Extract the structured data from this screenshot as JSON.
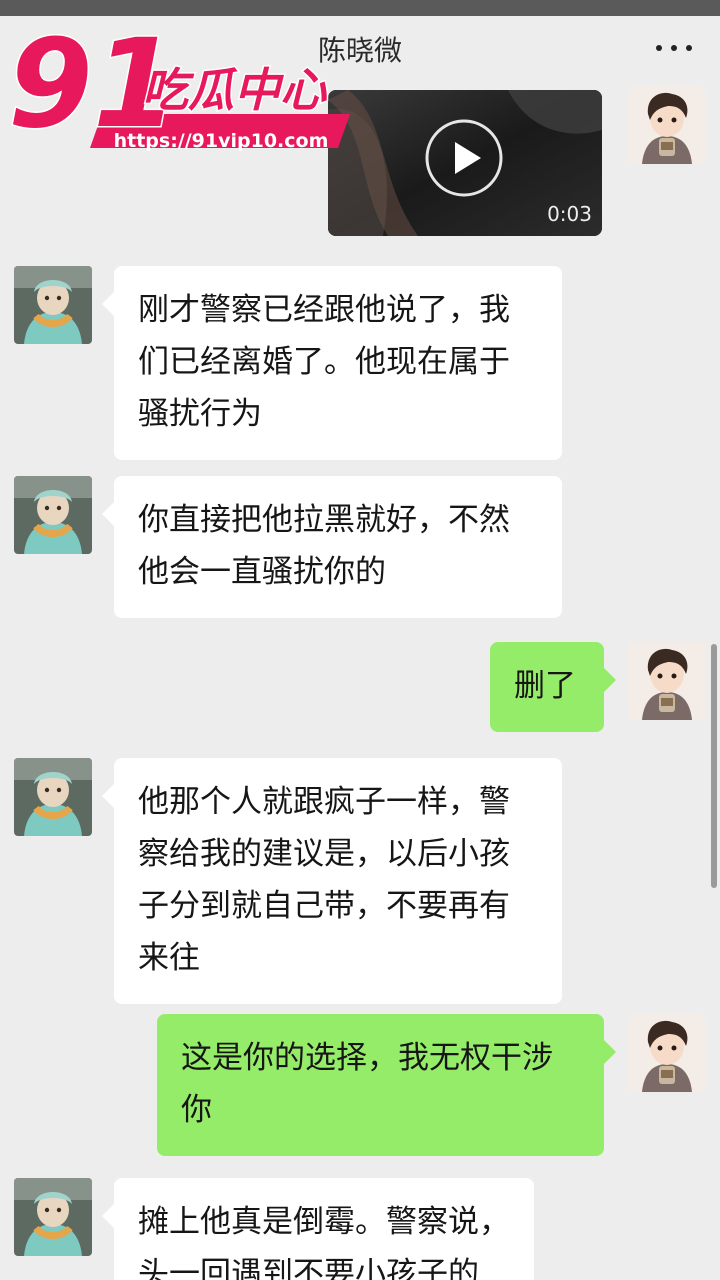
{
  "header": {
    "title": "陈晓微",
    "more_icon": "more-dots-icon"
  },
  "watermark": {
    "number": "91",
    "brand": "吃瓜中心",
    "url": "https://91vip10.com"
  },
  "video": {
    "duration": "0:03",
    "icon": "play-icon"
  },
  "messages": [
    {
      "side": "left",
      "text": "刚才警察已经跟他说了，我们已经离婚了。他现在属于骚扰行为"
    },
    {
      "side": "left",
      "text": "你直接把他拉黑就好，不然他会一直骚扰你的"
    },
    {
      "side": "right",
      "text": "删了"
    },
    {
      "side": "left",
      "text": "他那个人就跟疯子一样，警察给我的建议是，以后小孩子分到就自己带，不要再有来往"
    },
    {
      "side": "right",
      "text": "这是你的选择，我无权干涉你"
    },
    {
      "side": "left",
      "text": "摊上他真是倒霉。警察说，头一回遇到不要小孩子的"
    }
  ],
  "colors": {
    "background": "#ededed",
    "bubble_self": "#95ec69",
    "bubble_other": "#ffffff",
    "watermark_pink": "#e8185c"
  }
}
